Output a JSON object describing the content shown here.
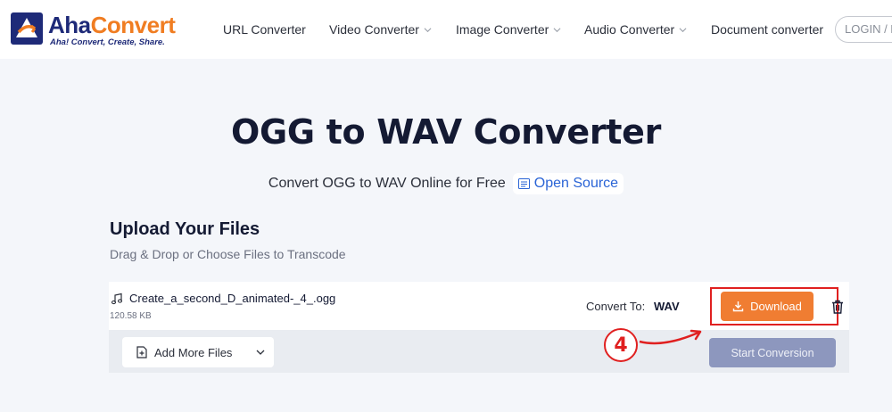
{
  "header": {
    "logo": {
      "name_part1": "Aha",
      "name_part2": "Convert",
      "tagline": "Aha! Convert, Create, Share."
    },
    "nav": [
      {
        "label": "URL Converter",
        "has_dropdown": false
      },
      {
        "label": "Video Converter",
        "has_dropdown": true
      },
      {
        "label": "Image Converter",
        "has_dropdown": true
      },
      {
        "label": "Audio Converter",
        "has_dropdown": true
      },
      {
        "label": "Document converter",
        "has_dropdown": false
      }
    ],
    "login_label": "LOGIN / R"
  },
  "hero": {
    "title": "OGG to WAV Converter",
    "subtitle": "Convert OGG to WAV Online for Free",
    "open_source_label": "Open Source"
  },
  "upload": {
    "title": "Upload Your Files",
    "subtitle": "Drag & Drop or Choose Files to Transcode"
  },
  "file": {
    "name": "Create_a_second_D_animated-_4_.ogg",
    "size": "120.58 KB",
    "convert_to_label": "Convert To:",
    "convert_to_value": "WAV",
    "download_label": "Download"
  },
  "actions": {
    "add_more_label": "Add More Files",
    "start_label": "Start Conversion"
  },
  "annotation": {
    "step": "4"
  },
  "colors": {
    "brand_navy": "#1e2a78",
    "brand_orange": "#f07d22",
    "download_bg": "#f07d32",
    "start_bg": "#8d97be",
    "highlight": "#e02020"
  }
}
